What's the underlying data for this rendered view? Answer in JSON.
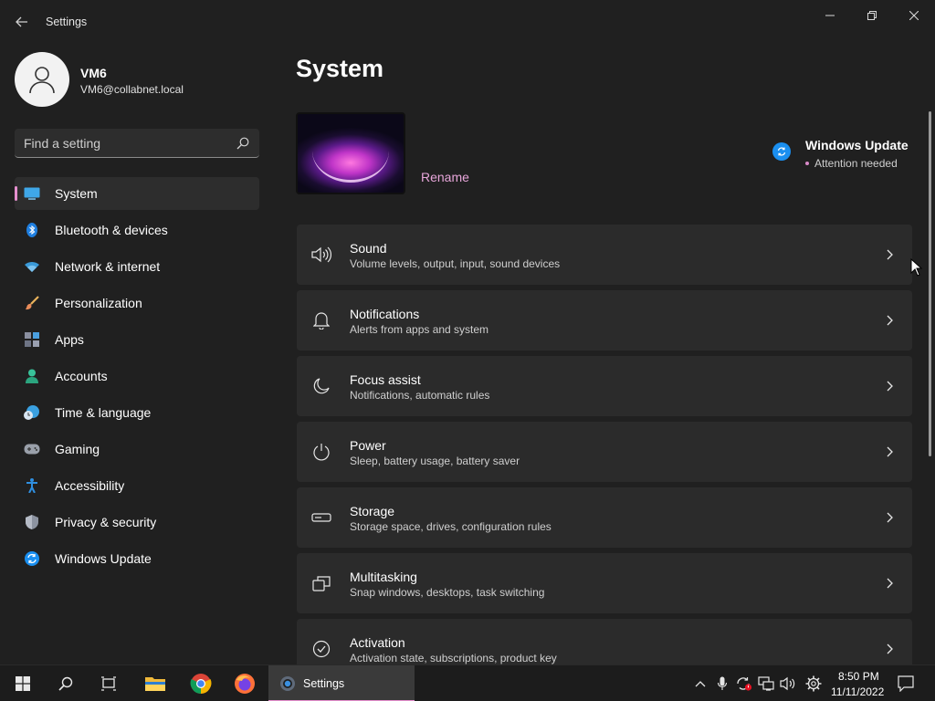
{
  "window": {
    "app_title": "Settings"
  },
  "profile": {
    "name": "VM6",
    "email": "VM6@collabnet.local"
  },
  "search": {
    "placeholder": "Find a setting"
  },
  "nav": {
    "items": [
      {
        "label": "System",
        "icon": "system-monitor-icon",
        "selected": true
      },
      {
        "label": "Bluetooth & devices",
        "icon": "bluetooth-icon"
      },
      {
        "label": "Network & internet",
        "icon": "wifi-icon"
      },
      {
        "label": "Personalization",
        "icon": "brush-icon"
      },
      {
        "label": "Apps",
        "icon": "apps-icon"
      },
      {
        "label": "Accounts",
        "icon": "person-icon"
      },
      {
        "label": "Time & language",
        "icon": "clock-globe-icon"
      },
      {
        "label": "Gaming",
        "icon": "gamepad-icon"
      },
      {
        "label": "Accessibility",
        "icon": "accessibility-icon"
      },
      {
        "label": "Privacy & security",
        "icon": "shield-icon"
      },
      {
        "label": "Windows Update",
        "icon": "update-icon"
      }
    ]
  },
  "main": {
    "title": "System",
    "rename_label": "Rename",
    "windows_update": {
      "title": "Windows Update",
      "status": "Attention needed"
    },
    "cards": [
      {
        "title": "Sound",
        "subtitle": "Volume levels, output, input, sound devices",
        "icon": "speaker-icon"
      },
      {
        "title": "Notifications",
        "subtitle": "Alerts from apps and system",
        "icon": "bell-icon"
      },
      {
        "title": "Focus assist",
        "subtitle": "Notifications, automatic rules",
        "icon": "moon-icon"
      },
      {
        "title": "Power",
        "subtitle": "Sleep, battery usage, battery saver",
        "icon": "power-icon"
      },
      {
        "title": "Storage",
        "subtitle": "Storage space, drives, configuration rules",
        "icon": "storage-icon"
      },
      {
        "title": "Multitasking",
        "subtitle": "Snap windows, desktops, task switching",
        "icon": "multitasking-icon"
      },
      {
        "title": "Activation",
        "subtitle": "Activation state, subscriptions, product key",
        "icon": "check-circle-icon"
      }
    ]
  },
  "taskbar": {
    "active_app": "Settings",
    "time": "8:50 PM",
    "date": "11/11/2022"
  },
  "colors": {
    "accent": "#e58fce",
    "background": "#202020",
    "card": "#2b2b2b"
  }
}
